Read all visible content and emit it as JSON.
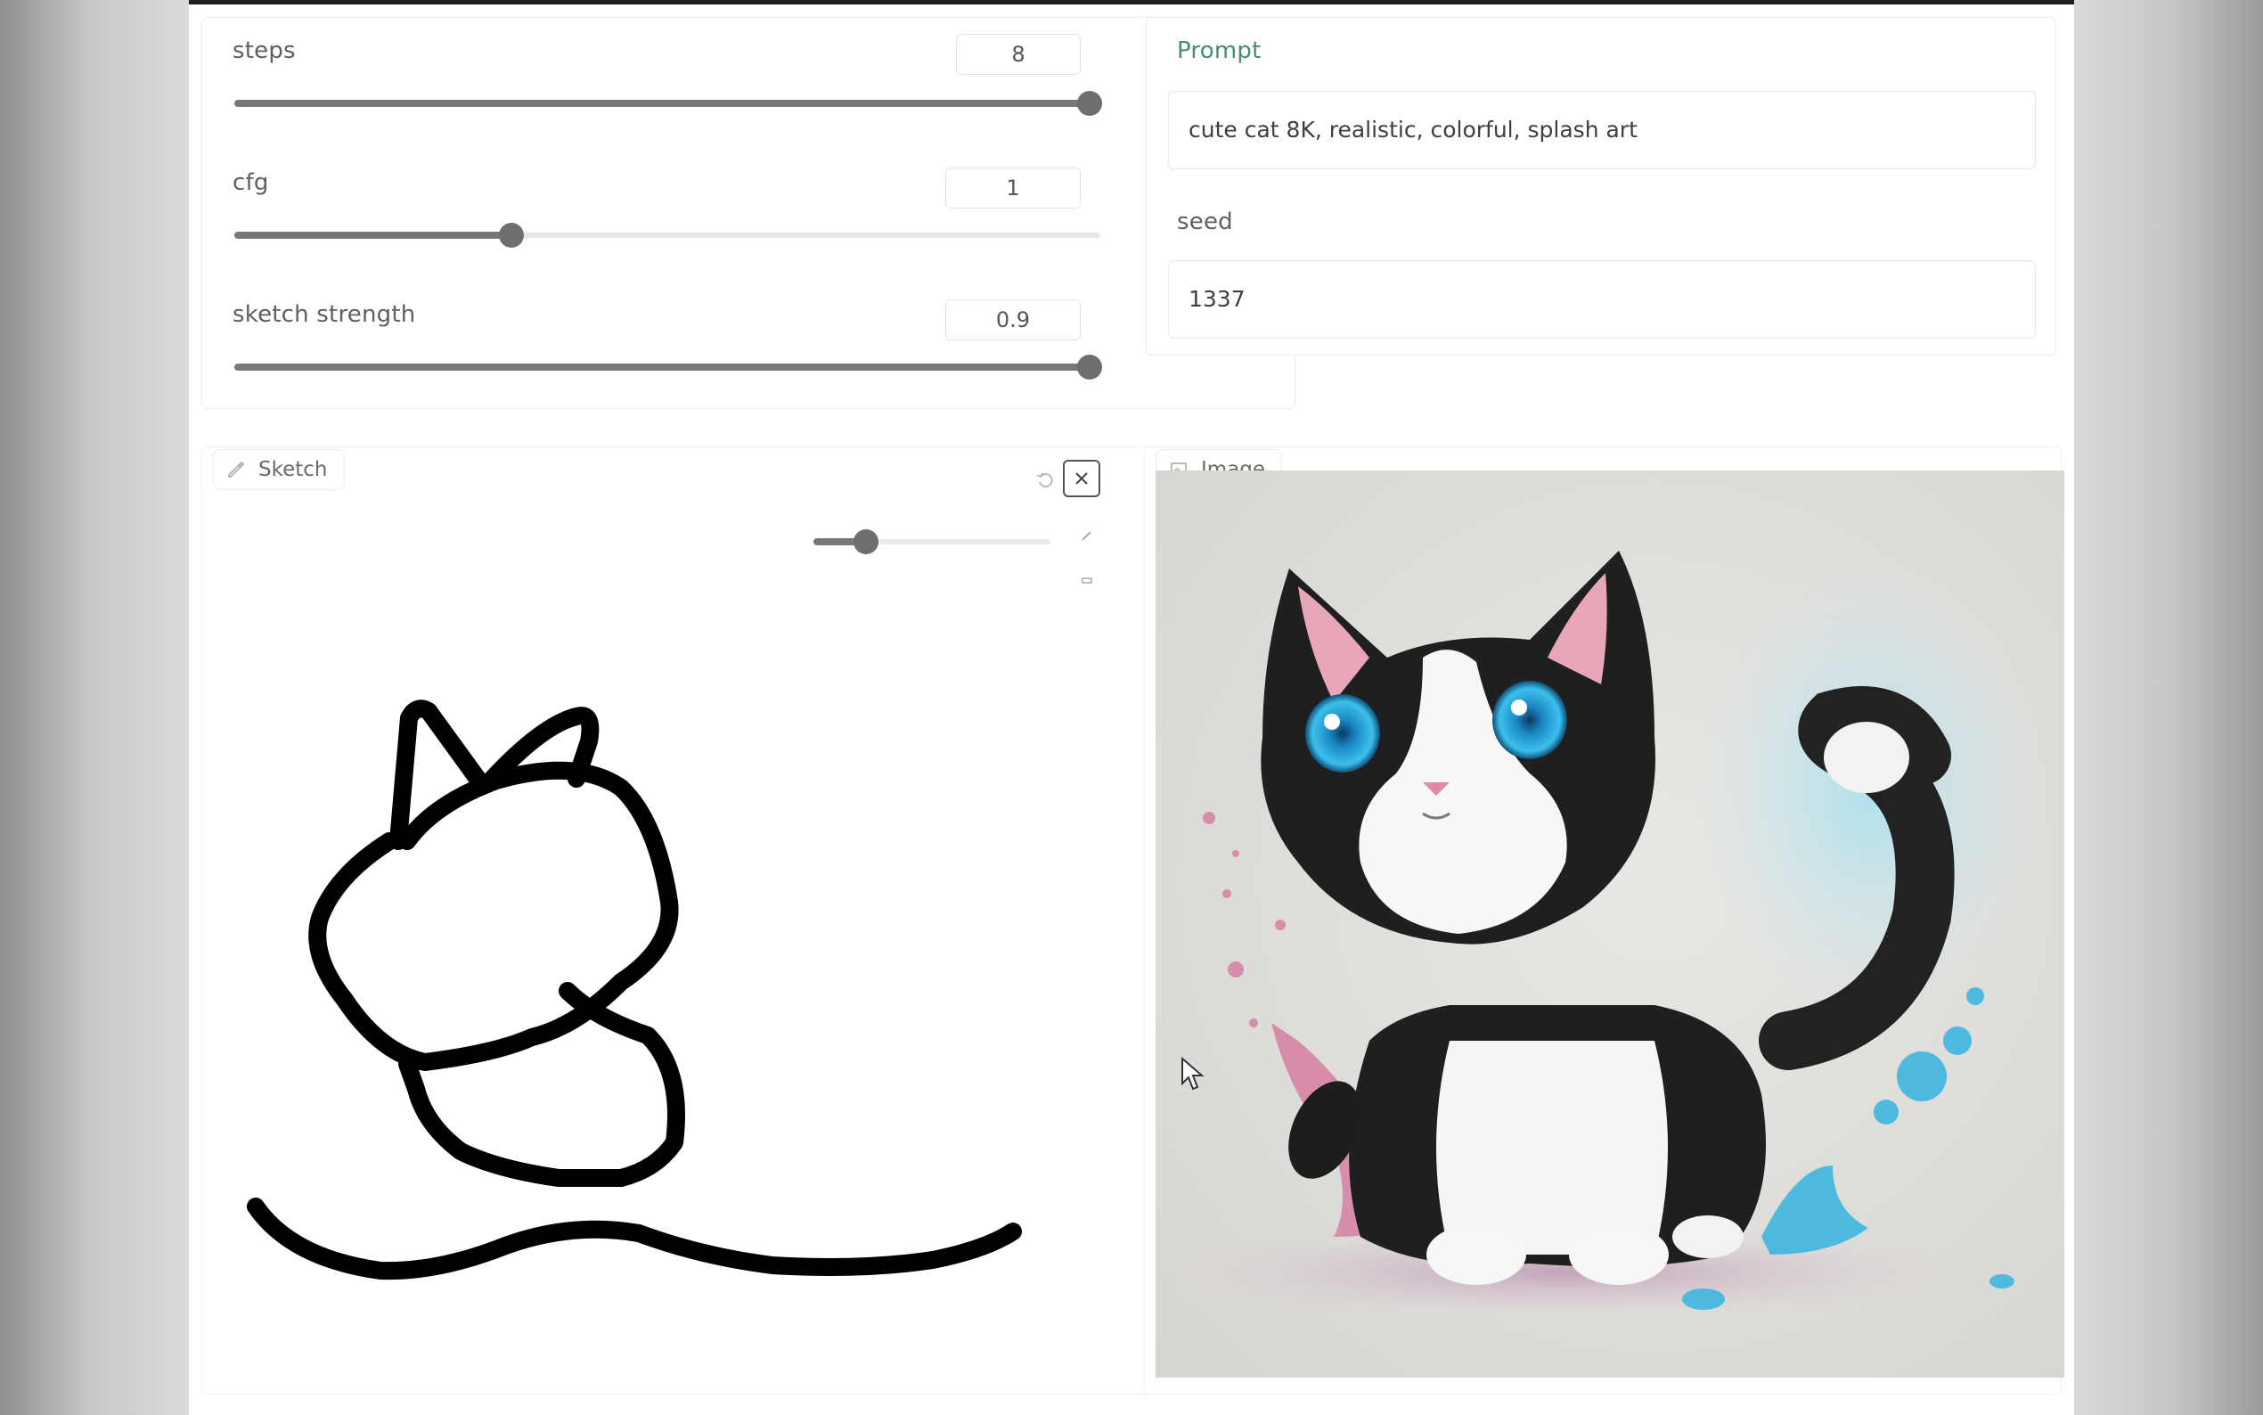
{
  "controls": {
    "steps": {
      "label": "steps",
      "value": "8",
      "fraction": 1.0
    },
    "cfg": {
      "label": "cfg",
      "value": "1",
      "fraction": 0.32
    },
    "sketch_strength": {
      "label": "sketch strength",
      "value": "0.9",
      "fraction": 1.0
    }
  },
  "prompt": {
    "label": "Prompt",
    "value": "cute cat 8K, realistic, colorful, splash art"
  },
  "seed": {
    "label": "seed",
    "value": "1337"
  },
  "sketch": {
    "tab_label": "Sketch",
    "brush_size_fraction": 0.22,
    "icons": [
      "pencil-icon",
      "undo-icon",
      "close-icon",
      "brush-icon",
      "eraser-icon"
    ]
  },
  "image": {
    "tab_label": "Image",
    "description_icons": [
      "image-icon",
      "download-icon"
    ]
  },
  "colors": {
    "accent_label": "#4a8a76",
    "slider": "#787878",
    "stroke": "#000000"
  }
}
